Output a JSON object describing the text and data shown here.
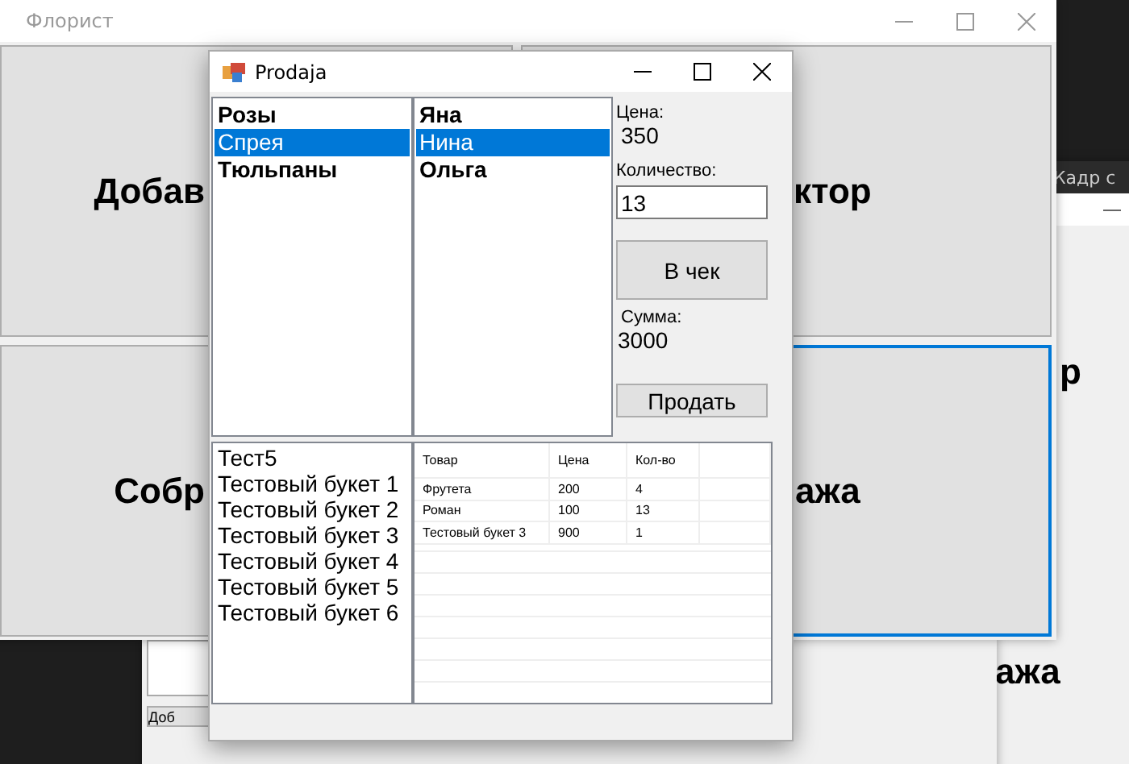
{
  "main_window": {
    "title": "Флорист",
    "buttons": [
      {
        "label": "Добав",
        "focused": false
      },
      {
        "label": "ктор",
        "focused": false
      },
      {
        "label": "Собр",
        "focused": false
      },
      {
        "label": "ажа",
        "focused": true
      }
    ]
  },
  "right_window": {
    "toolbar_text": "Кадр с",
    "texts": [
      "р",
      "ажа"
    ]
  },
  "bottom_window": {
    "button": "Доб"
  },
  "dialog": {
    "title": "Prodaja",
    "products": [
      {
        "label": "Розы",
        "selected": false
      },
      {
        "label": "Спрея",
        "selected": true
      },
      {
        "label": "Тюльпаны",
        "selected": false
      }
    ],
    "florists": [
      {
        "label": "Яна",
        "selected": false
      },
      {
        "label": "Нина",
        "selected": true
      },
      {
        "label": "Ольга",
        "selected": false
      }
    ],
    "price_label": "Цена:",
    "price": "350",
    "quantity_label": "Количество:",
    "quantity": "13",
    "add_button": "В чек",
    "sum_label": "Сумма:",
    "sum": "3000",
    "sell_button": "Продать",
    "bouquets": [
      "Тест5",
      "Тестовый букет 1",
      "Тестовый букет 2",
      "Тестовый букет 3",
      "Тестовый букет 4",
      "Тестовый букет 5",
      "Тестовый букет 6"
    ],
    "receipt": {
      "columns": [
        "Товар",
        "Цена",
        "Кол-во"
      ],
      "rows": [
        [
          "Фрутета",
          "200",
          "4"
        ],
        [
          "Роман",
          "100",
          "13"
        ],
        [
          "Тестовый букет 3",
          "900",
          "1"
        ]
      ]
    }
  }
}
